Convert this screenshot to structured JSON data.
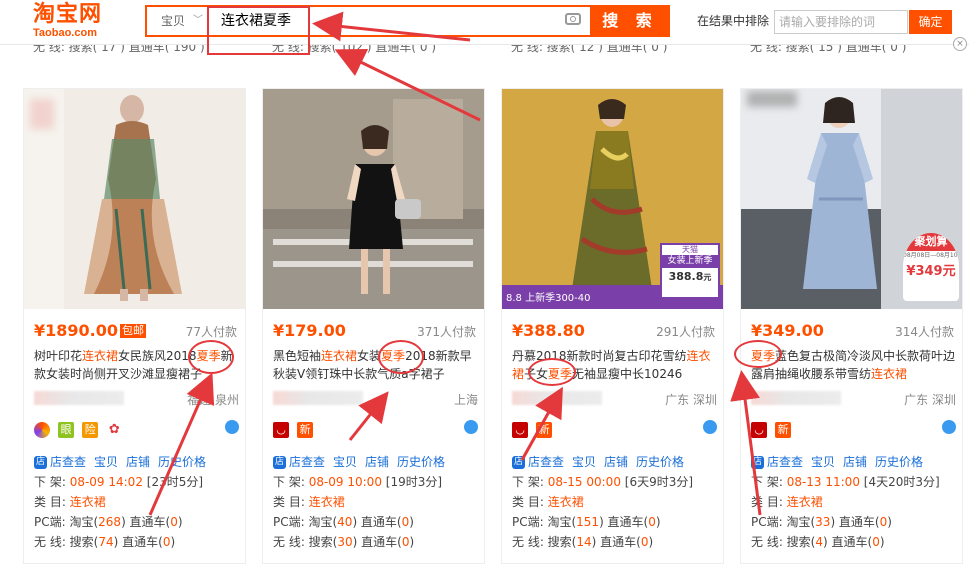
{
  "header": {
    "logo_cn": "淘宝网",
    "logo_en": "Taobao.com",
    "search_type": "宝贝",
    "search_query": "连衣裙夏季",
    "search_button": "搜 索",
    "exclude_label": "在结果中排除",
    "exclude_placeholder": "请输入要排除的词",
    "confirm_button": "确定"
  },
  "prev_row": [
    "无 线: 搜索( 17 )  直通车( 190 )",
    "无 线: 搜索( 102 )  直通车( 0 )",
    "无 线: 搜索( 12 )  直通车( 0 )",
    "无 线: 搜索( 15 )  直通车( 0 )"
  ],
  "products": [
    {
      "price": "¥1890.00",
      "baoyou": "包邮",
      "sales": "77人付款",
      "title_a": "树叶印花",
      "title_b": "连衣裙",
      "title_c": "女民族风2018",
      "title_d": "夏季",
      "title_e": "新款女装时尚侧开叉沙滩显瘦裙子",
      "location": "福建 泉州",
      "store_check": "店查查",
      "baobei": "宝贝",
      "dianpu": "店铺",
      "history": "历史价格",
      "shelf_label": "下 架: ",
      "shelf_date": "08-09 14:02",
      "shelf_remain": "[23时5分]",
      "category_label": "类 目: ",
      "category": "连衣裙",
      "pc_label": "PC端: 淘宝(",
      "pc_taobao": "268",
      "pc_zt_label": ") 直通车(",
      "pc_zt": "0",
      "mobile_label": "无 线: 搜索(",
      "mobile_search": "74",
      "mobile_zt_label": ") 直通车(",
      "mobile_zt": "0",
      "close_paren": ")"
    },
    {
      "price": "¥179.00",
      "baoyou": "",
      "sales": "371人付款",
      "title_a": "黑色短袖",
      "title_b": "连衣裙",
      "title_c": "女装",
      "title_d": "夏季",
      "title_e": "2018新款早秋装V领钉珠中长款气质a字裙子",
      "location": "上海",
      "store_check": "店查查",
      "baobei": "宝贝",
      "dianpu": "店铺",
      "history": "历史价格",
      "shelf_label": "下 架: ",
      "shelf_date": "08-09 10:00",
      "shelf_remain": "[19时3分]",
      "category_label": "类 目: ",
      "category": "连衣裙",
      "pc_label": "PC端: 淘宝(",
      "pc_taobao": "40",
      "pc_zt_label": ") 直通车(",
      "pc_zt": "0",
      "mobile_label": "无 线: 搜索(",
      "mobile_search": "30",
      "mobile_zt_label": ") 直通车(",
      "mobile_zt": "0",
      "close_paren": ")"
    },
    {
      "price": "¥388.80",
      "baoyou": "",
      "sales": "291人付款",
      "title_a": "丹慕2018新款时尚复古印花雪纺",
      "title_b": "连衣裙",
      "title_c": "子女",
      "title_d": "夏季",
      "title_e": "无袖显瘦中长10246",
      "location": "广东 深圳",
      "store_check": "店查查",
      "baobei": "宝贝",
      "dianpu": "店铺",
      "history": "历史价格",
      "shelf_label": "下 架: ",
      "shelf_date": "08-15 00:00",
      "shelf_remain": "[6天9时3分]",
      "category_label": "类 目: ",
      "category": "连衣裙",
      "pc_label": "PC端: 淘宝(",
      "pc_taobao": "151",
      "pc_zt_label": ") 直通车(",
      "pc_zt": "0",
      "mobile_label": "无 线: 搜索(",
      "mobile_search": "14",
      "mobile_zt_label": ") 直通车(",
      "mobile_zt": "0",
      "close_paren": ")",
      "img_badge_top": "天猫",
      "img_badge_mid": "女装上新季",
      "img_badge_price": "388.8",
      "img_badge_unit": "元",
      "img_banner": "8.8 上新季300-40"
    },
    {
      "price": "¥349.00",
      "baoyou": "",
      "sales": "314人付款",
      "title_a": "",
      "title_b": "",
      "title_c": "",
      "title_d": "夏季",
      "title_e": "蓝色复古极简冷淡风中长款荷叶边露肩抽绳收腰系带雪纺",
      "title_f": "连衣裙",
      "location": "广东 深圳",
      "store_check": "店查查",
      "baobei": "宝贝",
      "dianpu": "店铺",
      "history": "历史价格",
      "shelf_label": "下 架: ",
      "shelf_date": "08-13 11:00",
      "shelf_remain": "[4天20时3分]",
      "category_label": "类 目: ",
      "category": "连衣裙",
      "pc_label": "PC端: 淘宝(",
      "pc_taobao": "33",
      "pc_zt_label": ") 直通车(",
      "pc_zt": "0",
      "mobile_label": "无 线: 搜索(",
      "mobile_search": "4",
      "mobile_zt_label": ") 直通车(",
      "mobile_zt": "0",
      "close_paren": ")",
      "img_badge_title": "聚划算",
      "img_badge_sub": "08月08日—08月10日",
      "img_badge_price": "¥349元"
    }
  ],
  "icons": {
    "card1": [
      "tmall-orange-icon",
      "yan-icon",
      "xian-icon",
      "flower-icon"
    ],
    "card2": [
      "tmall-icon",
      "xin-icon"
    ],
    "card3": [
      "tmall-icon",
      "xin-icon"
    ],
    "card4": [
      "tmall-icon",
      "xin-icon"
    ],
    "icon_labels": {
      "yan": "眼",
      "xian": "险",
      "xin": "新"
    }
  },
  "colors": {
    "accent": "#ff5000",
    "link": "#1a6fd8",
    "annotation": "#e4393c"
  }
}
